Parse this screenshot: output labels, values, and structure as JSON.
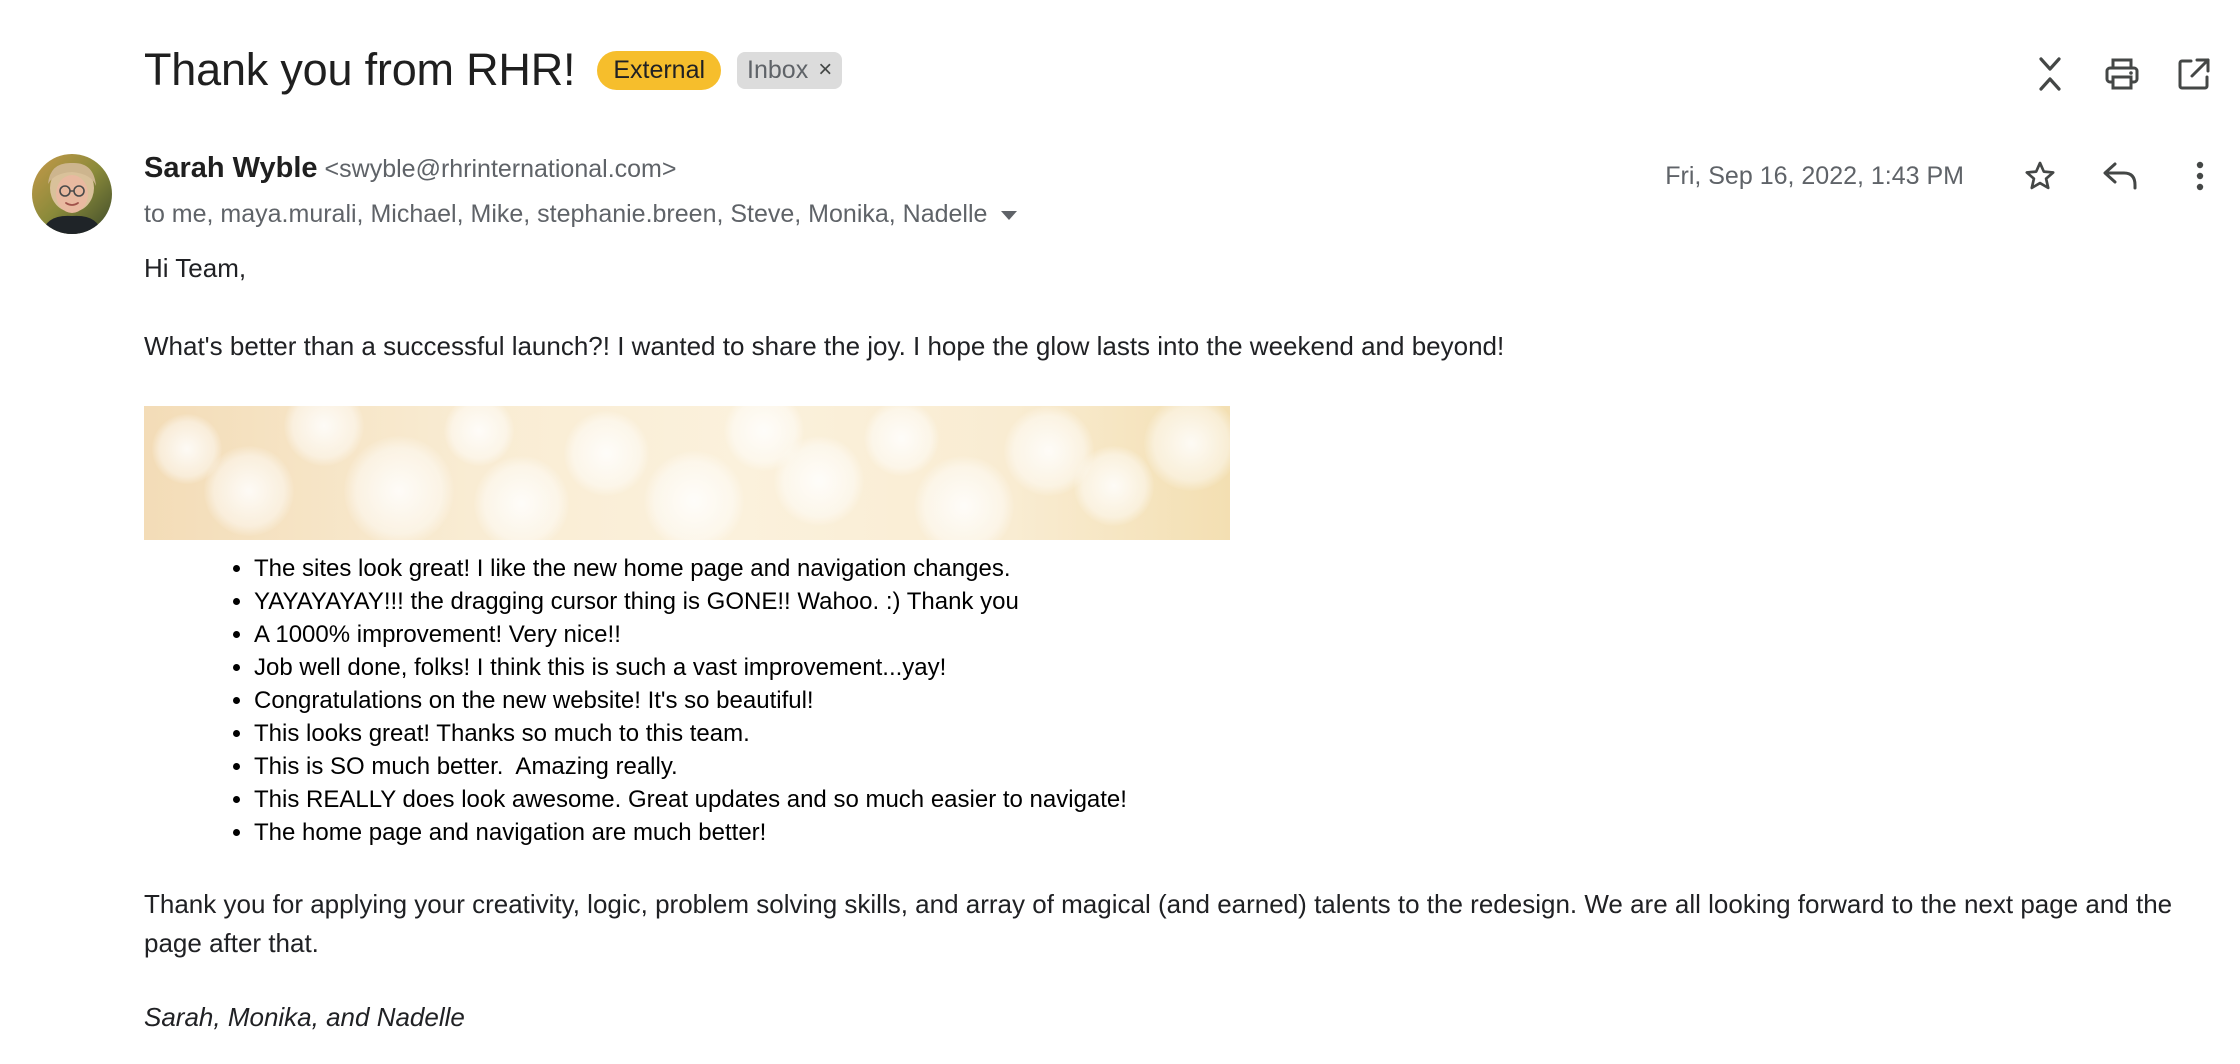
{
  "email": {
    "subject": "Thank you from RHR!",
    "labels": {
      "external": "External",
      "inbox": "Inbox",
      "remove_glyph": "×"
    },
    "sender": {
      "name": "Sarah Wyble",
      "email": "<swyble@rhrinternational.com>"
    },
    "recipients": "to me, maya.murali, Michael, Mike, stephanie.breen, Steve, Monika, Nadelle",
    "date": "Fri, Sep 16, 2022, 1:43 PM",
    "top_actions": [
      "collapse-all-icon",
      "print-icon",
      "open-in-new-window-icon"
    ],
    "message_actions": [
      "star-icon",
      "reply-icon",
      "more-vert-icon"
    ]
  },
  "body": {
    "greeting": "Hi Team,",
    "intro": "What's better than a successful launch?! I wanted to share the joy. I hope the glow lasts into the weekend and beyond!",
    "quotes": [
      "The sites look great! I like the new home page and navigation changes.",
      "YAYAYAYAY!!! the dragging cursor thing is GONE!! Wahoo. :) Thank you",
      "A 1000% improvement! Very nice!!",
      "Job well done, folks! I think this is such a vast improvement...yay!",
      "Congratulations on the new website! It's so beautiful!",
      "This looks great! Thanks so much to this team.",
      "This is SO much better.  Amazing really.",
      "This REALLY does look awesome. Great updates and so much easier to navigate!",
      "The home page and navigation are much better!"
    ],
    "closing": "Thank you for applying your creativity, logic, problem solving skills, and array of magical (and earned) talents to the redesign. We are all looking forward to the next page and the page after that.",
    "signature": "Sarah, Monika, and Nadelle"
  },
  "colors": {
    "external_label": "#f6be2c",
    "inbox_label": "#dcdcdc",
    "secondary_text": "#5f6368",
    "primary_text": "#202124"
  }
}
